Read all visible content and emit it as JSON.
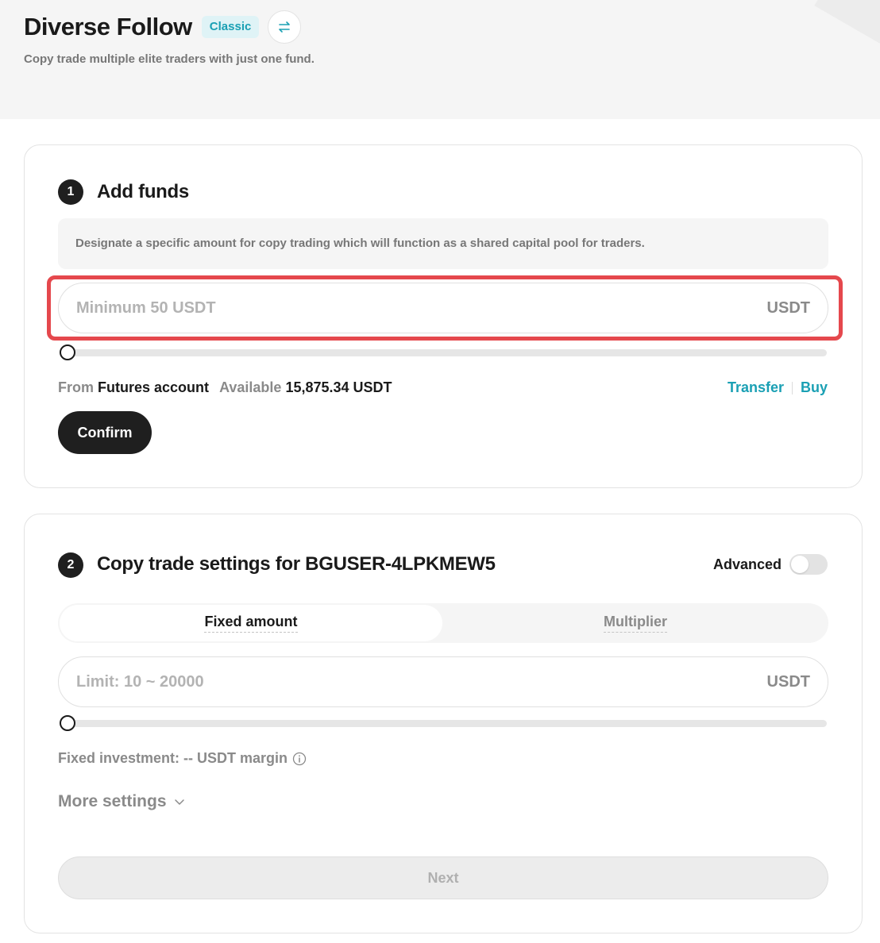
{
  "header": {
    "title": "Diverse Follow",
    "badge": "Classic",
    "subtitle": "Copy trade multiple elite traders with just one fund."
  },
  "step1": {
    "number": "1",
    "title": "Add funds",
    "info": "Designate a specific amount for copy trading which will function as a shared capital pool for traders.",
    "input_placeholder": "Minimum 50 USDT",
    "input_value": "",
    "unit": "USDT",
    "slider_value": 0,
    "from_label": "From",
    "account_name": "Futures account",
    "available_label": "Available",
    "available_value": "15,875.34 USDT",
    "transfer_label": "Transfer",
    "buy_label": "Buy",
    "confirm_label": "Confirm"
  },
  "step2": {
    "number": "2",
    "title": "Copy trade settings for BGUSER-4LPKMEW5",
    "advanced_label": "Advanced",
    "advanced_enabled": false,
    "tabs": [
      {
        "label": "Fixed amount",
        "active": true
      },
      {
        "label": "Multiplier",
        "active": false
      }
    ],
    "input_placeholder": "Limit: 10 ~ 20000",
    "input_value": "",
    "unit": "USDT",
    "slider_value": 0,
    "fixed_investment": "Fixed investment: -- USDT margin",
    "more_settings_label": "More settings",
    "next_label": "Next"
  },
  "colors": {
    "accent": "#1aa0b4",
    "highlight": "#e5484d",
    "dark": "#1f1f1f"
  },
  "icons": {
    "switch": "swap-arrows-icon",
    "info": "info-icon",
    "chevron": "chevron-down-icon"
  }
}
